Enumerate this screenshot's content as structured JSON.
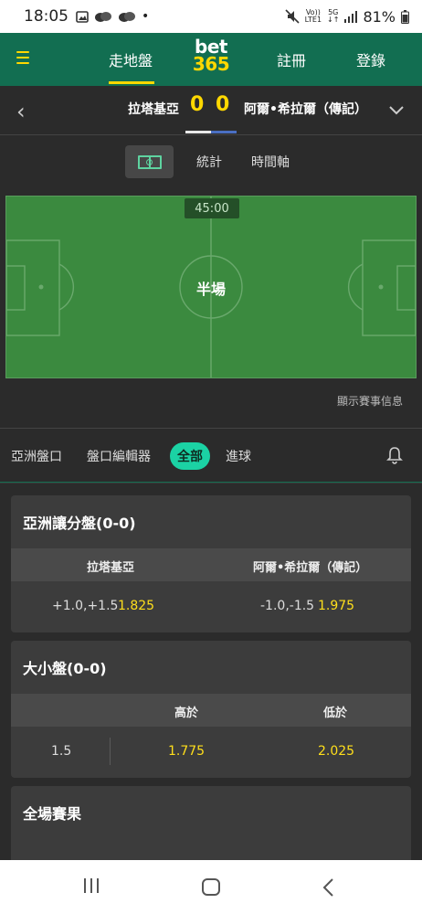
{
  "status_bar": {
    "time": "18:05",
    "dot": "•",
    "network_lines": [
      "Vo))",
      "LTE1"
    ],
    "signal": [
      "5G",
      "↓↑"
    ],
    "battery": "81%"
  },
  "header": {
    "live_label": "走地盤",
    "logo_top": "bet",
    "logo_bottom": "365",
    "register_label": "註冊",
    "login_label": "登錄"
  },
  "match": {
    "home_team": "拉塔基亞",
    "away_team": "阿爾•希拉爾（傳記）",
    "home_score": "0",
    "away_score": "0"
  },
  "view_tabs": {
    "stats_label": "統計",
    "timeline_label": "時間軸"
  },
  "pitch": {
    "clock": "45:00",
    "status": "半場",
    "show_match_info": "顯示賽事信息"
  },
  "market_tabs": {
    "asian_label": "亞洲盤口",
    "builder_label": "盤口編輯器",
    "all_label": "全部",
    "goals_label": "進球"
  },
  "markets": {
    "handicap": {
      "title": "亞洲讓分盤(0-0)",
      "home_header": "拉塔基亞",
      "away_header": "阿爾•希拉爾（傳記）",
      "home_line": "+1.0,+1.5",
      "home_odds": "1.825",
      "away_line": "-1.0,-1.5",
      "away_odds": "1.975"
    },
    "totals": {
      "title": "大小盤(0-0)",
      "over_header": "高於",
      "under_header": "低於",
      "line": "1.5",
      "over_odds": "1.775",
      "under_odds": "2.025"
    },
    "fulltime": {
      "title": "全場賽果"
    }
  },
  "colors": {
    "header_green": "#126e51",
    "accent_yellow": "#ffd800",
    "odds_yellow": "#ffdf1b",
    "all_pill": "#1bd2a4",
    "pitch_green": "#3b8a3f"
  },
  "icons": [
    "image-icon",
    "notification-icon",
    "mute-icon",
    "battery-icon",
    "menu-icon",
    "back-chevron-icon",
    "dropdown-chevron-icon",
    "pitch-icon",
    "bell-icon"
  ]
}
